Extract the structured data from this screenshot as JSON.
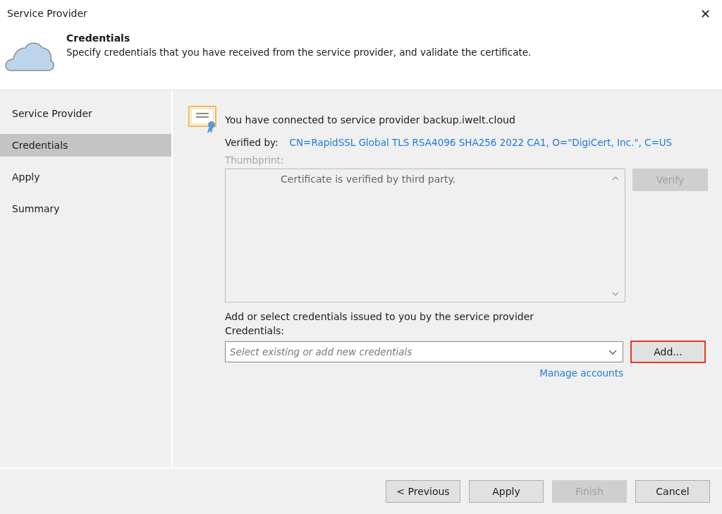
{
  "window": {
    "title": "Service Provider",
    "close": "✕"
  },
  "header": {
    "title": "Credentials",
    "description": "Specify credentials that you have received from the service provider, and validate the certificate."
  },
  "sidebar": {
    "items": [
      {
        "label": "Service Provider",
        "selected": false
      },
      {
        "label": "Credentials",
        "selected": true
      },
      {
        "label": "Apply",
        "selected": false
      },
      {
        "label": "Summary",
        "selected": false
      }
    ]
  },
  "certificate": {
    "message": "You have connected to service provider backup.iwelt.cloud",
    "verified_by_label": "Verified by:",
    "verified_by_value": "CN=RapidSSL Global TLS RSA4096 SHA256 2022 CA1, O=\"DigiCert, Inc.\", C=US",
    "thumbprint_label": "Thumbprint:",
    "thumbprint_disabled": true,
    "thumbprint_text": "Certificate is verified by third party.",
    "verify_button": {
      "label": "Verify",
      "disabled": true
    }
  },
  "credentials": {
    "hint": "Add or select credentials issued to you by the service provider",
    "label": "Credentials:",
    "placeholder": "Select existing or add new credentials",
    "add_button": {
      "label": "Add...",
      "highlighted": true
    },
    "manage_link": "Manage accounts"
  },
  "buttons": [
    {
      "label": "< Previous",
      "disabled": false
    },
    {
      "label": "Apply",
      "disabled": false
    },
    {
      "label": "Finish",
      "disabled": true
    },
    {
      "label": "Cancel",
      "disabled": false
    }
  ]
}
